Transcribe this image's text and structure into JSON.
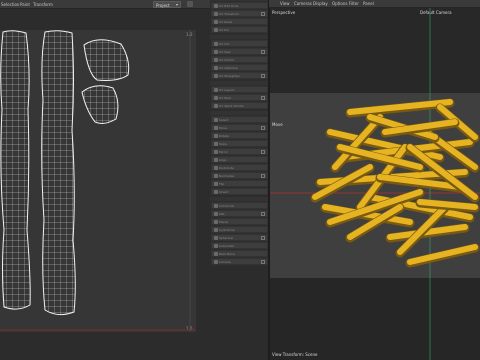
{
  "uv_editor": {
    "menu": [
      "Selection",
      "Paint",
      "Transform"
    ],
    "project_dropdown": "Project",
    "ticks": {
      "top_right": "1.0",
      "bottom_right": "1.0"
    }
  },
  "tool_panel": {
    "groups": [
      [
        "UV Edit Tools",
        "UV Transform",
        "UV Relax",
        "UV Pin"
      ],
      [
        "UV Cut",
        "UV Sew",
        "UV Unfold",
        "UV Optimize",
        "UV Straighten"
      ],
      [
        "UV Layout",
        "UV Pack",
        "UV Stack Similar"
      ],
      [
        "Select",
        "Move",
        "Rotate",
        "Scale",
        "Mirror",
        "Align",
        "Distribute",
        "Normalize",
        "Flip",
        "Orient"
      ],
      [
        "Unfold 3D",
        "Pelt",
        "Planar",
        "Cylindrical",
        "Spherical",
        "Automatic",
        "Best Plane",
        "Camera"
      ]
    ]
  },
  "viewport": {
    "menu": [
      "View",
      "Cameras",
      "Display",
      "Options",
      "Filter",
      "Panel"
    ],
    "perspective_label": "Perspective",
    "camera_label": "Default Camera",
    "mode_label": "Move",
    "footer_label": "View Transform: Scene"
  },
  "colors": {
    "fry_light": "#e6b422",
    "fry_dark": "#7a5a10",
    "axis_red": "#b43232",
    "axis_green": "#3aa86a",
    "uv_line": "#e8e8e8"
  }
}
